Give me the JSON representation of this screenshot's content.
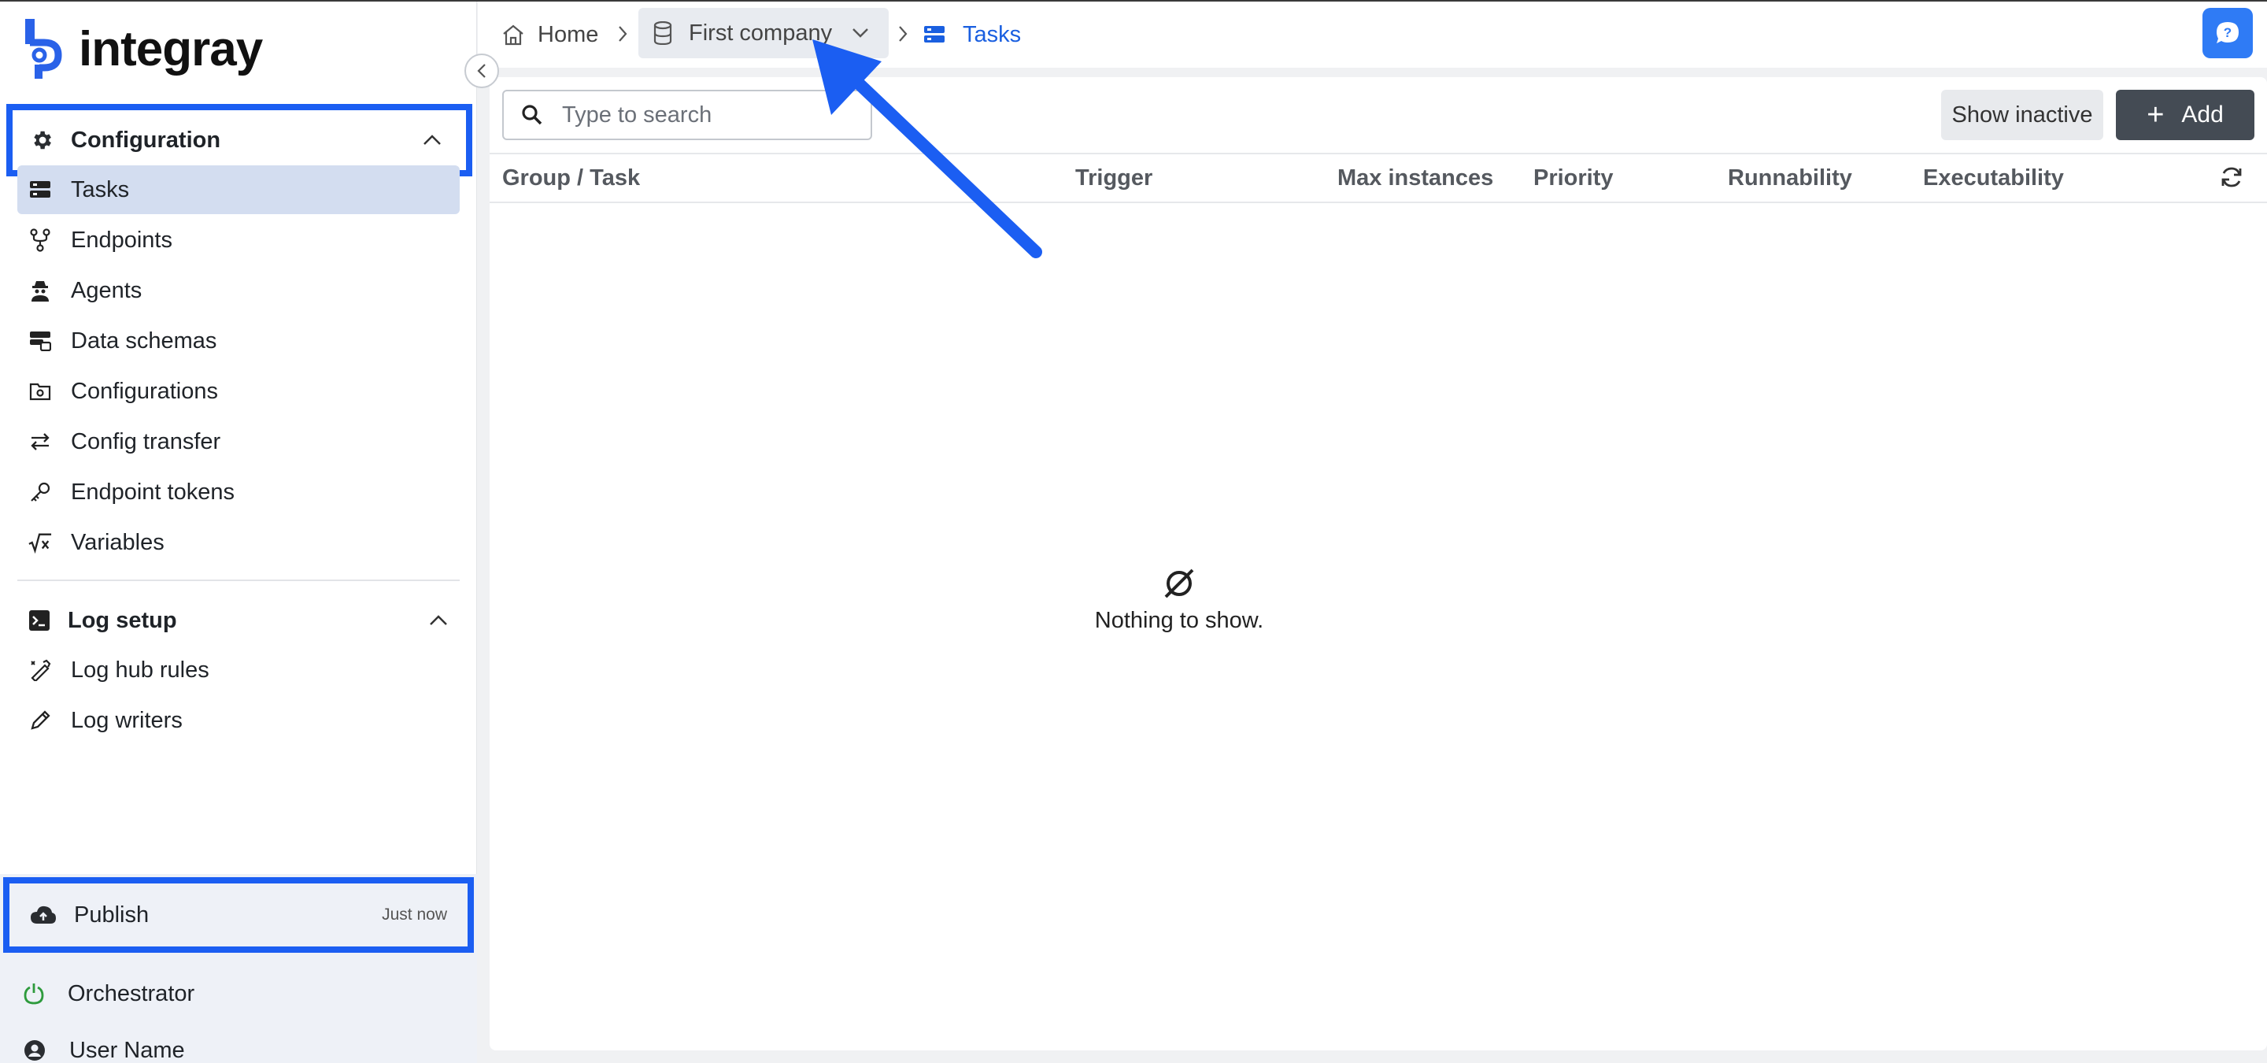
{
  "app": {
    "logo_text": "integray"
  },
  "sidebar": {
    "configuration": {
      "title": "Configuration",
      "items": [
        {
          "label": "Tasks",
          "icon": "tasks-icon",
          "active": true
        },
        {
          "label": "Endpoints",
          "icon": "endpoints-icon"
        },
        {
          "label": "Agents",
          "icon": "agent-icon"
        },
        {
          "label": "Data schemas",
          "icon": "data-schema-icon"
        },
        {
          "label": "Configurations",
          "icon": "configurations-icon"
        },
        {
          "label": "Config transfer",
          "icon": "transfer-icon"
        },
        {
          "label": "Endpoint tokens",
          "icon": "key-icon"
        },
        {
          "label": "Variables",
          "icon": "variables-icon"
        }
      ]
    },
    "log_setup": {
      "title": "Log setup",
      "items": [
        {
          "label": "Log hub rules",
          "icon": "log-hub-rules-icon"
        },
        {
          "label": "Log writers",
          "icon": "pencil-icon"
        }
      ]
    },
    "bottom": {
      "publish": {
        "label": "Publish",
        "time": "Just now"
      },
      "orchestrator": {
        "label": "Orchestrator",
        "status_color": "#2e9b3d"
      },
      "user": {
        "label": "User Name"
      }
    }
  },
  "breadcrumb": {
    "home": "Home",
    "company": "First company",
    "tasks": "Tasks"
  },
  "toolbar": {
    "search_placeholder": "Type to search",
    "show_inactive": "Show inactive",
    "add": "Add"
  },
  "table": {
    "columns": [
      "Group / Task",
      "Trigger",
      "Max instances",
      "Priority",
      "Runnability",
      "Executability"
    ],
    "rows": []
  },
  "empty_state": {
    "message": "Nothing to show."
  },
  "colors": {
    "accent": "#1b5ef2",
    "active_nav": "#d3ddf0",
    "link": "#1a5fe0",
    "add_button": "#444b54",
    "annotation": "#1b5ef2"
  }
}
